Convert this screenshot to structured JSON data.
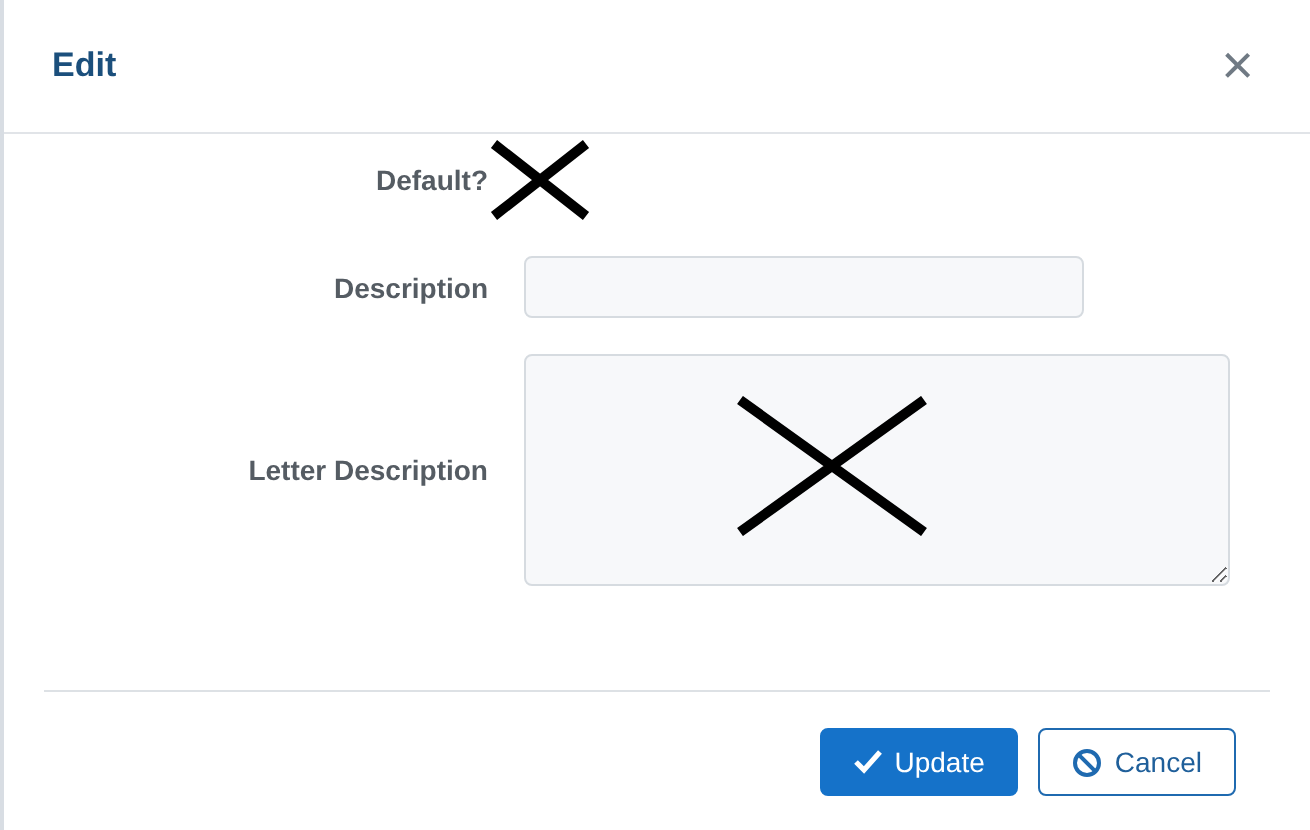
{
  "dialog": {
    "title": "Edit",
    "close": "×"
  },
  "fields": [
    {
      "kind": "mark",
      "label": "Default?"
    },
    {
      "kind": "input",
      "label": "Description"
    },
    {
      "kind": "textarea",
      "label": "Letter Description"
    }
  ],
  "buttons": [
    {
      "kind": "primary",
      "label": "Update"
    },
    {
      "kind": "secondary",
      "label": "Cancel"
    }
  ]
}
